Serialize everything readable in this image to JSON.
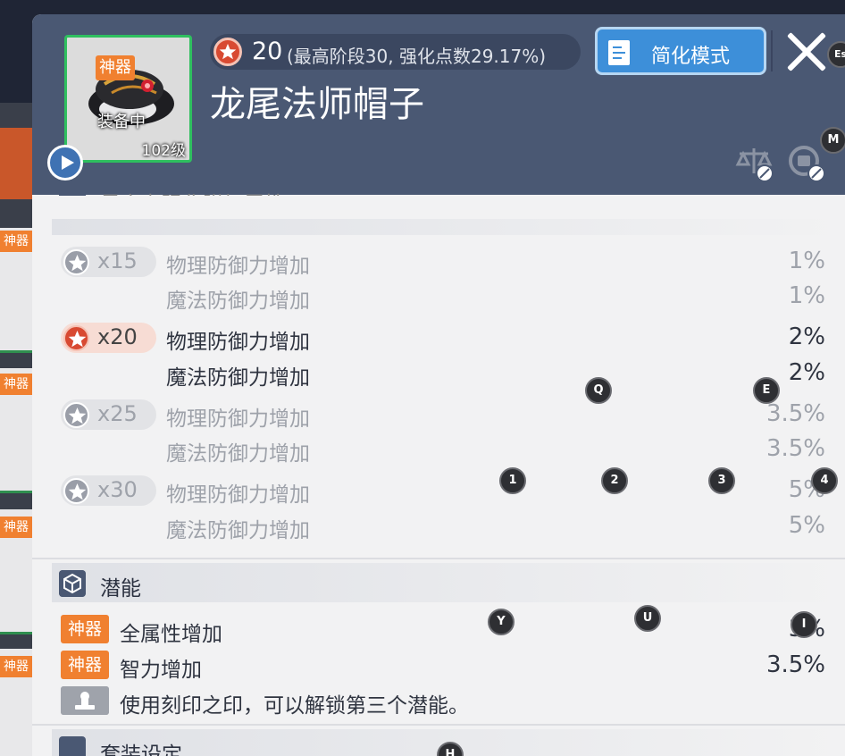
{
  "background": {
    "tags": [
      "神器",
      "神器",
      "神器",
      "神器"
    ]
  },
  "item": {
    "grade_badge": "神器",
    "equipped_label": "装备中",
    "level_label": "102级",
    "name": "龙尾法师帽子"
  },
  "star_force": {
    "current": "20",
    "description": "(最高阶段30, 强化点数29.17%)"
  },
  "toolbar": {
    "simple_mode_label": "简化模式"
  },
  "star_section": {
    "title": "星之力强化附加属性",
    "tiers": [
      {
        "level": "x15",
        "active": false,
        "stats": [
          {
            "name": "物理防御力增加",
            "value": "1%"
          },
          {
            "name": "魔法防御力增加",
            "value": "1%"
          }
        ]
      },
      {
        "level": "x20",
        "active": true,
        "stats": [
          {
            "name": "物理防御力增加",
            "value": "2%"
          },
          {
            "name": "魔法防御力增加",
            "value": "2%"
          }
        ]
      },
      {
        "level": "x25",
        "active": false,
        "stats": [
          {
            "name": "物理防御力增加",
            "value": "3.5%"
          },
          {
            "name": "魔法防御力增加",
            "value": "3.5%"
          }
        ]
      },
      {
        "level": "x30",
        "active": false,
        "stats": [
          {
            "name": "物理防御力增加",
            "value": "5%"
          },
          {
            "name": "魔法防御力增加",
            "value": "5%"
          }
        ]
      }
    ]
  },
  "potential_section": {
    "title": "潜能",
    "lines": [
      {
        "badge": "神器",
        "text": "全属性增加",
        "value": "3%"
      },
      {
        "badge": "神器",
        "text": "智力增加",
        "value": "3.5%"
      }
    ],
    "unlock_hint": "使用刻印之印，可以解锁第三个潜能。"
  },
  "set_section": {
    "title": "套装设定"
  },
  "hotkeys": {
    "esc": "Es",
    "m": "M",
    "q": "Q",
    "e": "E",
    "k1": "1",
    "k2": "2",
    "k3": "3",
    "k4": "4",
    "y": "Y",
    "u": "U",
    "i": "I",
    "h": "H"
  },
  "colors": {
    "header_bg": "#4a5873",
    "panel_bg": "#f2f2f3",
    "accent_blue": "#3d8fd9",
    "artifact_orange": "#f08030",
    "star_red": "#d84a32",
    "frame_green": "#2fbf5f"
  }
}
